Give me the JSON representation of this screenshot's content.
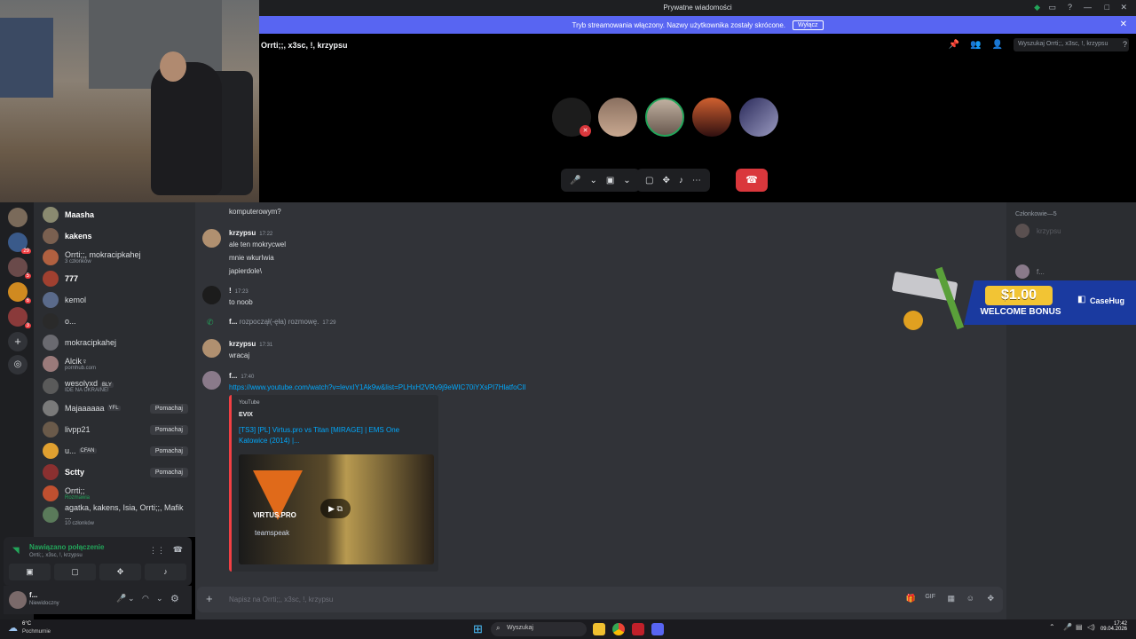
{
  "window": {
    "title": "Prywatne wiadomości"
  },
  "banner": {
    "text": "Tryb streamowania włączony. Nazwy użytkownika zostały skrócone.",
    "button": "Wyłącz"
  },
  "call": {
    "name": "Orrti;;, x3sc, !, krzypsu",
    "search_placeholder": "Wyszukaj Orrti;;, x3sc, !, krzypsu"
  },
  "dm_list": [
    {
      "name": "Maasha",
      "sub": ""
    },
    {
      "name": "kakens",
      "sub": ""
    },
    {
      "name": "Orrti;;, mokracipkahej",
      "sub": "3 członków"
    },
    {
      "name": "777",
      "sub": ""
    },
    {
      "name": "kemol",
      "sub": ""
    },
    {
      "name": "o...",
      "sub": ""
    },
    {
      "name": "mokracipkahej",
      "sub": ""
    },
    {
      "name": "Alcik♀",
      "sub": "pornhub.com"
    },
    {
      "name": "wesolyxd",
      "tag": "BLY",
      "sub": "IDE NA UKRAINE!"
    },
    {
      "name": "Majaaaaaa",
      "tag": "YFL",
      "wave": "Pomachaj"
    },
    {
      "name": "livpp21",
      "wave": "Pomachaj"
    },
    {
      "name": "u...",
      "tag": "CFAN",
      "wave": "Pomachaj"
    },
    {
      "name": "Sctty",
      "wave": "Pomachaj"
    },
    {
      "name": "Orrti;;",
      "sub": "Rozmawia"
    },
    {
      "name": "agatka, kakens, Isia, Orrti;;, Mafik ...",
      "sub": "10 członków"
    }
  ],
  "voice": {
    "status": "Nawiązano połączenie",
    "channel": "Orrti;;, x3sc, !, krzypsu"
  },
  "user": {
    "name": "f...",
    "status": "Niewidoczny"
  },
  "messages": {
    "m0": "komputerowym?",
    "m1_author": "krzypsu",
    "m1_time": "17:22",
    "m1_l1": "ale ten mokrycwel",
    "m1_l2": "mnie wkurIwia",
    "m1_l3": "japierdole\\",
    "m2_author": "!",
    "m2_time": "17:23",
    "m2_l1": "to noob",
    "m3_author": "f...",
    "m3_text": "rozpoczął(-ęła) rozmowę.",
    "m3_time": "17:29",
    "m4_author": "krzypsu",
    "m4_time": "17:31",
    "m4_l1": "wracaj",
    "m5_author": "f...",
    "m5_time": "17:40",
    "m5_link": "https://www.youtube.com/watch?v=levxIY1Ak9w&list=PLHxH2VRv9j9eWIC70iYXsPI7HlatfoCIl"
  },
  "embed": {
    "provider": "YouTube",
    "author": "EVIX",
    "title": "[TS3] [PL] Virtus.pro vs Titan [MIRAGE] | EMS One Katowice (2014) |...",
    "thumb_text": "VIRTUS.PRO",
    "thumb_sub": "teamspeak"
  },
  "input": {
    "placeholder": "Napisz na Orrti;;, x3sc, !, krzypsu"
  },
  "members": {
    "header": "Członkowie—5",
    "m1": "krzypsu",
    "m2": "f..."
  },
  "ad": {
    "price": "$1.00",
    "bonus": "WELCOME BONUS",
    "brand": "CaseHug"
  },
  "taskbar": {
    "weather": "6°C",
    "weather_desc": "Pochmurnie",
    "search": "Wyszukaj",
    "time": "17:42",
    "date": "09.04.2026"
  },
  "colors": {
    "accent": "#5865f2",
    "danger": "#da373c",
    "link": "#00a8fc",
    "online": "#23a55a"
  }
}
